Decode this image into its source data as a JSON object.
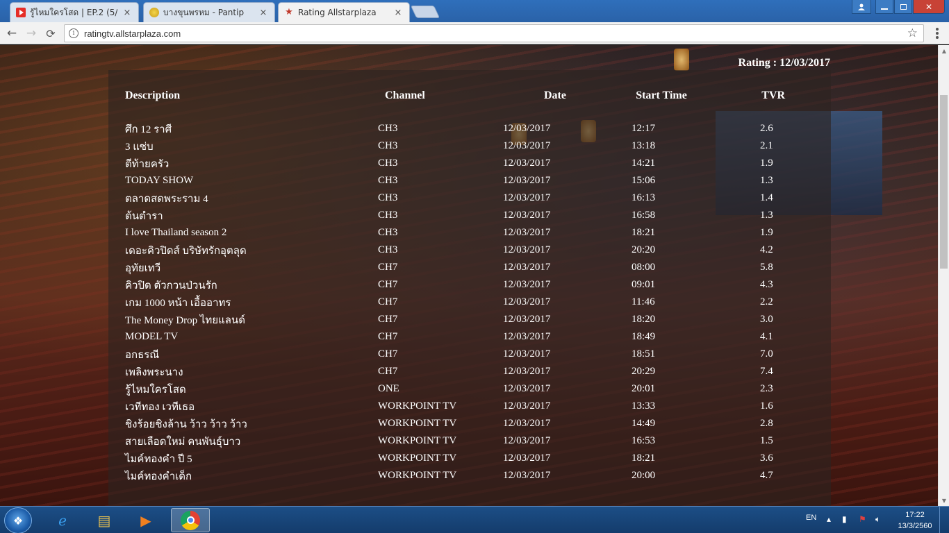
{
  "browser": {
    "tabs": [
      {
        "title": "รู้ไหมใครโสด | EP.2 (5/5",
        "favicon": "youtube-icon",
        "close": "×"
      },
      {
        "title": "บางขุนพรหม - Pantip",
        "favicon": "pantip-icon",
        "close": "×"
      },
      {
        "title": "Rating Allstarplaza",
        "favicon": "star-icon",
        "close": "×"
      }
    ],
    "url": "ratingtv.allstarplaza.com"
  },
  "page": {
    "rating_title": "Rating : 12/03/2017",
    "headers": {
      "description": "Description",
      "channel": "Channel",
      "date": "Date",
      "start_time": "Start Time",
      "tvr": "TVR"
    },
    "rows": [
      {
        "description": "ศึก 12 ราศี",
        "channel": "CH3",
        "date": "12/03/2017",
        "start_time": "12:17",
        "tvr": "2.6"
      },
      {
        "description": "3 แซ่บ",
        "channel": "CH3",
        "date": "12/03/2017",
        "start_time": "13:18",
        "tvr": "2.1"
      },
      {
        "description": "ตีท้ายครัว",
        "channel": "CH3",
        "date": "12/03/2017",
        "start_time": "14:21",
        "tvr": "1.9"
      },
      {
        "description": "TODAY SHOW",
        "channel": "CH3",
        "date": "12/03/2017",
        "start_time": "15:06",
        "tvr": "1.3"
      },
      {
        "description": "ตลาดสดพระราม 4",
        "channel": "CH3",
        "date": "12/03/2017",
        "start_time": "16:13",
        "tvr": "1.4"
      },
      {
        "description": "ต้นตำรา",
        "channel": "CH3",
        "date": "12/03/2017",
        "start_time": "16:58",
        "tvr": "1.3"
      },
      {
        "description": "I love Thailand season 2",
        "channel": "CH3",
        "date": "12/03/2017",
        "start_time": "18:21",
        "tvr": "1.9"
      },
      {
        "description": "เดอะคิวปิดส์ บริษัทรักอุตลุด",
        "channel": "CH3",
        "date": "12/03/2017",
        "start_time": "20:20",
        "tvr": "4.2"
      },
      {
        "description": "อุทัยเทวี",
        "channel": "CH7",
        "date": "12/03/2017",
        "start_time": "08:00",
        "tvr": "5.8"
      },
      {
        "description": "คิวปิด ตัวกวนป่วนรัก",
        "channel": "CH7",
        "date": "12/03/2017",
        "start_time": "09:01",
        "tvr": "4.3"
      },
      {
        "description": "เกม 1000 หน้า เอื้ออาทร",
        "channel": "CH7",
        "date": "12/03/2017",
        "start_time": "11:46",
        "tvr": "2.2"
      },
      {
        "description": "The Money Drop ไทยแลนด์",
        "channel": "CH7",
        "date": "12/03/2017",
        "start_time": "18:20",
        "tvr": "3.0"
      },
      {
        "description": "MODEL TV",
        "channel": "CH7",
        "date": "12/03/2017",
        "start_time": "18:49",
        "tvr": "4.1"
      },
      {
        "description": "อกธรณี",
        "channel": "CH7",
        "date": "12/03/2017",
        "start_time": "18:51",
        "tvr": "7.0"
      },
      {
        "description": "เพลิงพระนาง",
        "channel": "CH7",
        "date": "12/03/2017",
        "start_time": "20:29",
        "tvr": "7.4"
      },
      {
        "description": "รู้ไหมใครโสด",
        "channel": "ONE",
        "date": "12/03/2017",
        "start_time": "20:01",
        "tvr": "2.3"
      },
      {
        "description": "เวทีทอง เวทีเธอ",
        "channel": "WORKPOINT TV",
        "date": "12/03/2017",
        "start_time": "13:33",
        "tvr": "1.6"
      },
      {
        "description": "ชิงร้อยชิงล้าน ว้าว ว้าว ว้าว",
        "channel": "WORKPOINT TV",
        "date": "12/03/2017",
        "start_time": "14:49",
        "tvr": "2.8"
      },
      {
        "description": "สายเลือดใหม่ คนพันธุ์บาว",
        "channel": "WORKPOINT TV",
        "date": "12/03/2017",
        "start_time": "16:53",
        "tvr": "1.5"
      },
      {
        "description": "ไมค์ทองคำ ปี 5",
        "channel": "WORKPOINT TV",
        "date": "12/03/2017",
        "start_time": "18:21",
        "tvr": "3.6"
      },
      {
        "description": "ไมค์ทองคำเด็ก",
        "channel": "WORKPOINT TV",
        "date": "12/03/2017",
        "start_time": "20:00",
        "tvr": "4.7"
      }
    ]
  },
  "taskbar": {
    "language": "EN",
    "time": "17:22",
    "date": "13/3/2560"
  },
  "colors": {
    "accent": "#2a62a8",
    "close": "#c84236",
    "table_text": "#ffffff"
  }
}
